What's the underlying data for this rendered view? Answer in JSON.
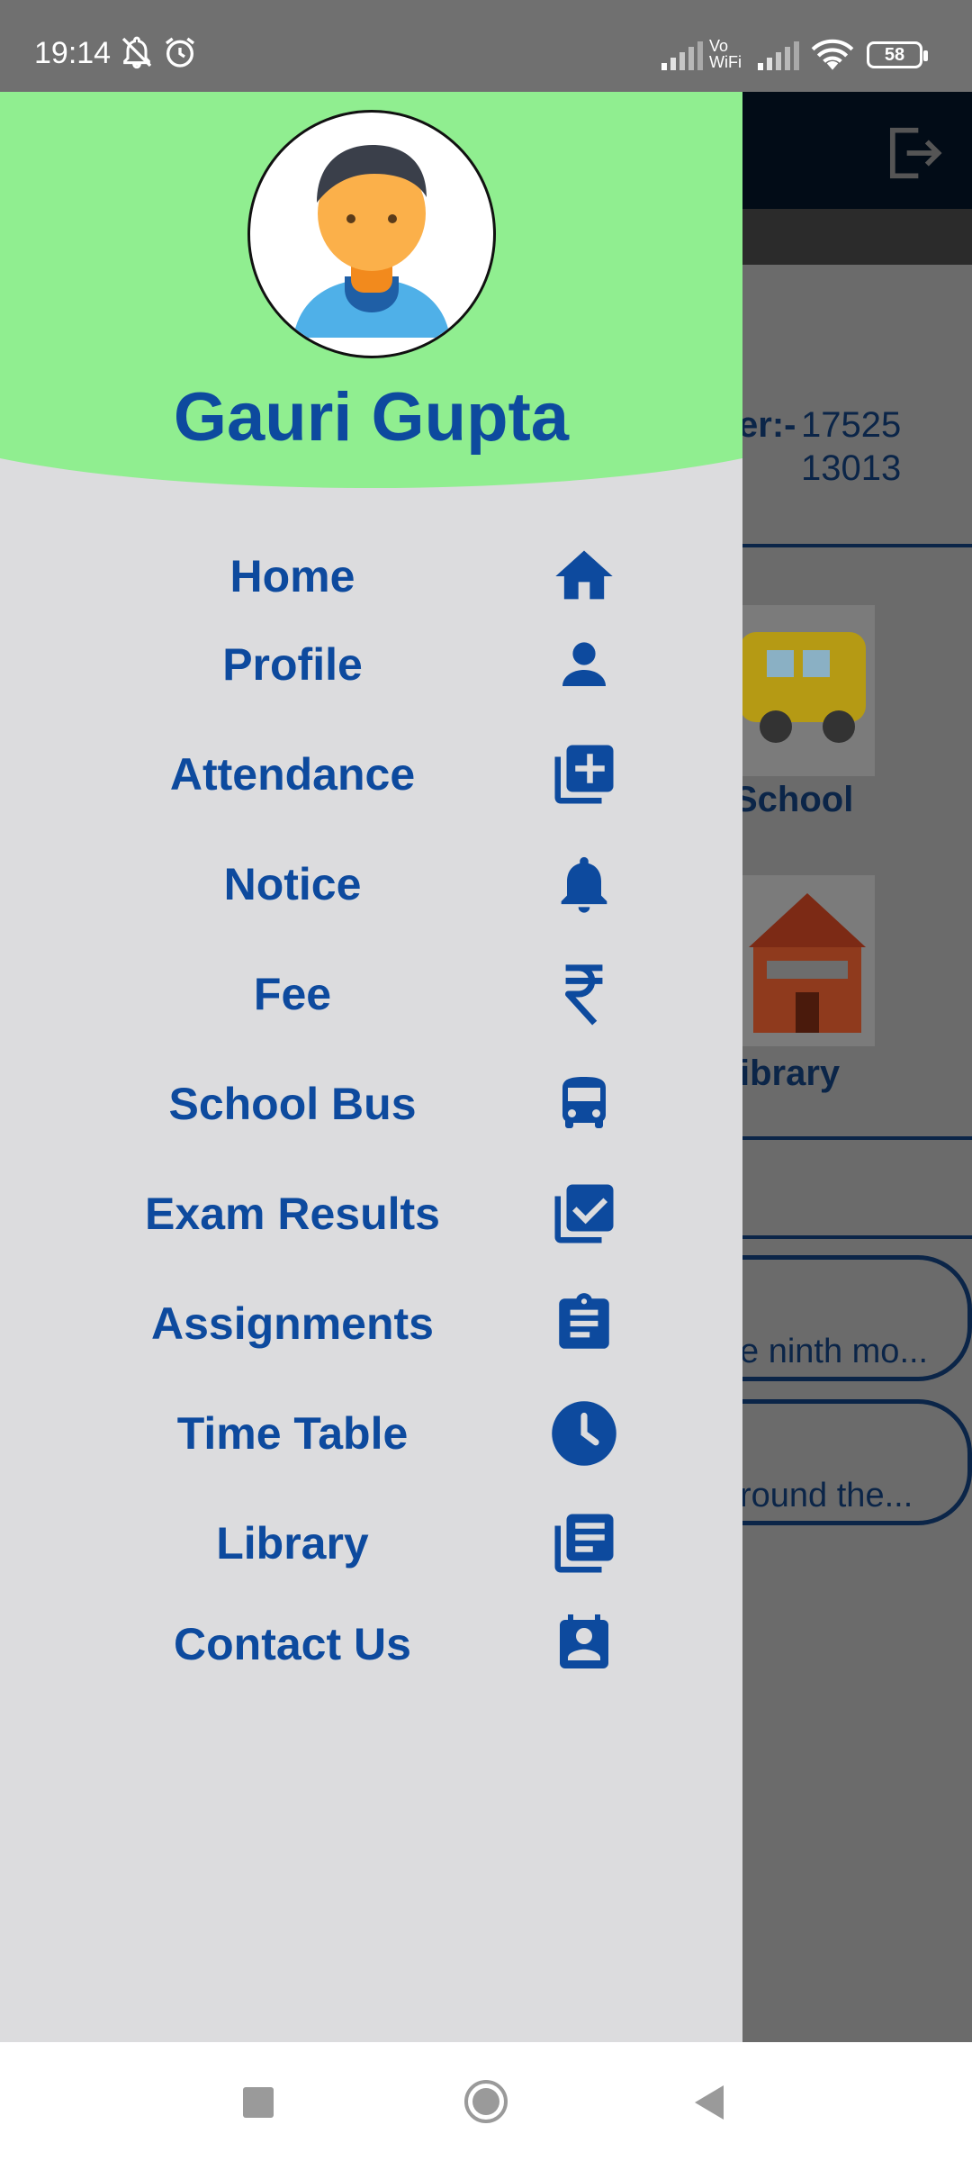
{
  "status_bar": {
    "time": "19:14",
    "battery": "58",
    "icons": [
      "mute-bell-icon",
      "alarm-icon",
      "signal-icon",
      "vowifi-icon",
      "signal-icon",
      "wifi-icon",
      "battery-icon"
    ],
    "vowifi_top": "Vo",
    "vowifi_bottom": "WiFi"
  },
  "background": {
    "reg_label_fragment": "er:-",
    "reg_value": "17525",
    "roll_value": "13013",
    "tile_school_fragment": "School",
    "tile_library_fragment": "ibrary",
    "notice1_fragment": "e ninth mo...",
    "notice2_fragment": "round the..."
  },
  "drawer": {
    "header_color": "#90ee90",
    "accent_color": "#0d4a9e",
    "user_name": "Gauri Gupta",
    "avatar_icon": "user-avatar-icon",
    "menu": [
      {
        "label": "Home",
        "icon": "home-icon"
      },
      {
        "label": "Profile",
        "icon": "person-icon"
      },
      {
        "label": "Attendance",
        "icon": "add-box-icon"
      },
      {
        "label": "Notice",
        "icon": "bell-icon"
      },
      {
        "label": "Fee",
        "icon": "rupee-icon"
      },
      {
        "label": "School Bus",
        "icon": "bus-icon"
      },
      {
        "label": "Exam Results",
        "icon": "checklist-icon"
      },
      {
        "label": "Assignments",
        "icon": "clipboard-icon"
      },
      {
        "label": "Time Table",
        "icon": "clock-icon"
      },
      {
        "label": "Library",
        "icon": "library-books-icon"
      },
      {
        "label": "Contact Us",
        "icon": "contact-card-icon"
      }
    ]
  },
  "nav_bar": {
    "buttons": [
      "recents-icon",
      "home-circle-icon",
      "back-triangle-icon"
    ]
  }
}
